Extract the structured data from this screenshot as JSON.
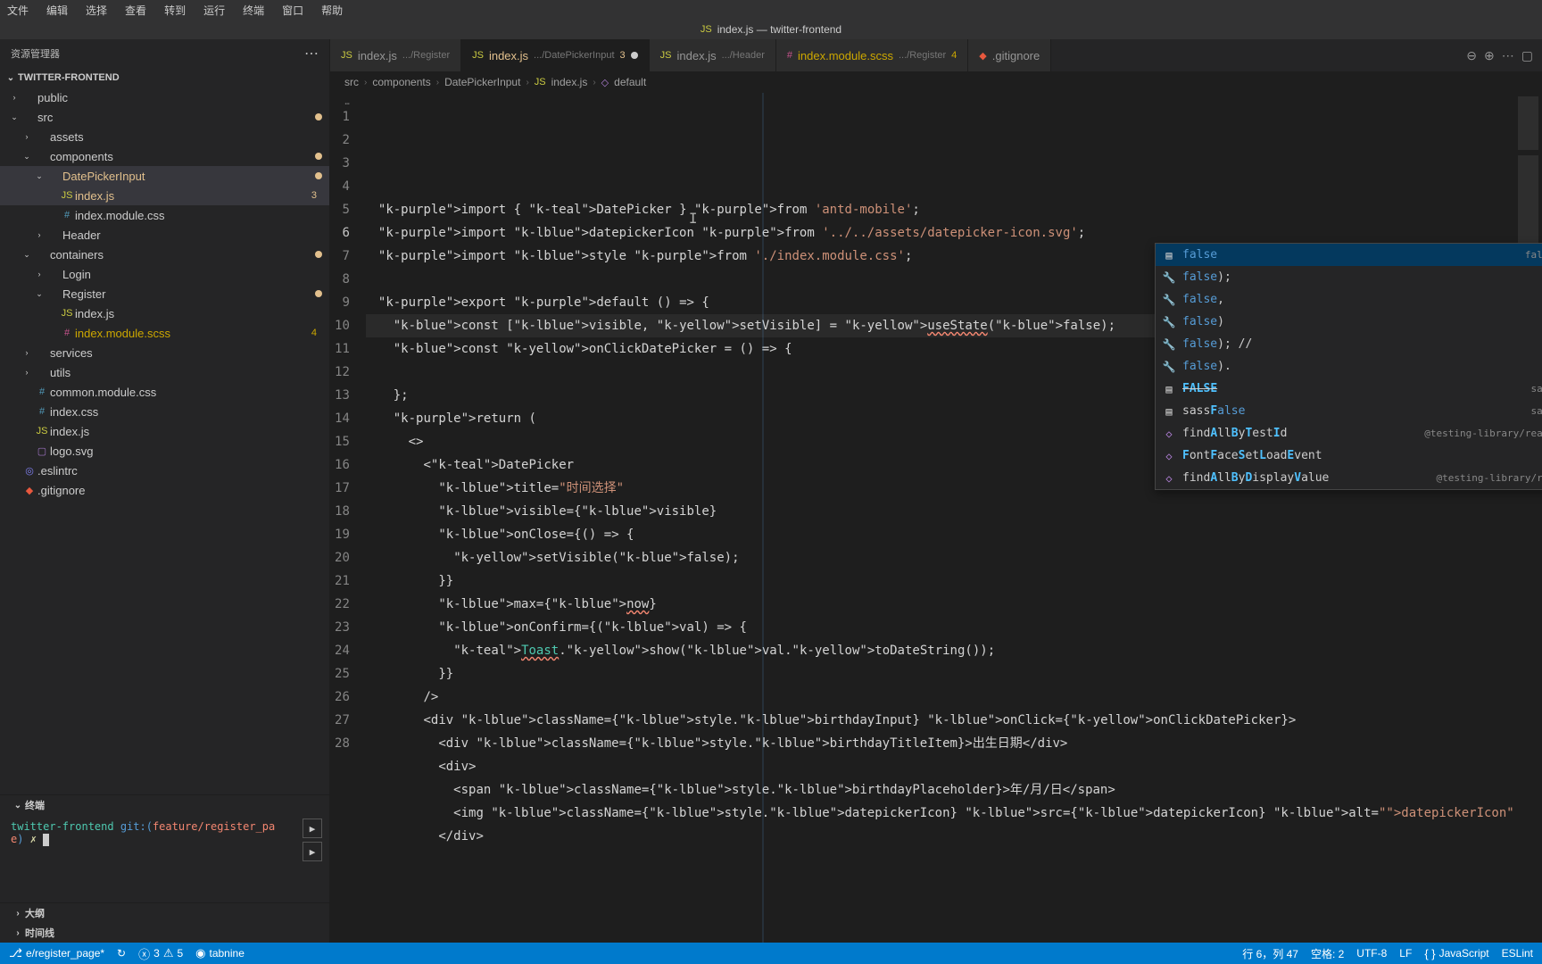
{
  "menubar": [
    "文件",
    "编辑",
    "选择",
    "查看",
    "转到",
    "运行",
    "终端",
    "窗口",
    "帮助"
  ],
  "title": "index.js — twitter-frontend",
  "sidebar": {
    "header": "资源管理器",
    "project": "TWITTER-FRONTEND",
    "tree": [
      {
        "d": 0,
        "exp": ">",
        "icon": "folder",
        "label": "public"
      },
      {
        "d": 0,
        "exp": "v",
        "icon": "folder",
        "label": "src",
        "dot": "#e2c08d"
      },
      {
        "d": 1,
        "exp": ">",
        "icon": "folder",
        "label": "assets"
      },
      {
        "d": 1,
        "exp": "v",
        "icon": "folder",
        "label": "components",
        "dot": "#e2c08d"
      },
      {
        "d": 2,
        "exp": "v",
        "icon": "folder",
        "label": "DatePickerInput",
        "dot": "#e2c08d",
        "active": true,
        "cls": "orange"
      },
      {
        "d": 3,
        "icon": "js",
        "label": "index.js",
        "badge": "3",
        "cls": "orange",
        "active": true
      },
      {
        "d": 3,
        "icon": "css",
        "label": "index.module.css"
      },
      {
        "d": 2,
        "exp": ">",
        "icon": "folder",
        "label": "Header"
      },
      {
        "d": 1,
        "exp": "v",
        "icon": "folder",
        "label": "containers",
        "dot": "#e2c08d"
      },
      {
        "d": 2,
        "exp": ">",
        "icon": "folder",
        "label": "Login"
      },
      {
        "d": 2,
        "exp": "v",
        "icon": "folder",
        "label": "Register",
        "dot": "#e2c08d"
      },
      {
        "d": 3,
        "icon": "js",
        "label": "index.js"
      },
      {
        "d": 3,
        "icon": "scss",
        "label": "index.module.scss",
        "badge": "4",
        "cls": "yellow"
      },
      {
        "d": 1,
        "exp": ">",
        "icon": "folder",
        "label": "services"
      },
      {
        "d": 1,
        "exp": ">",
        "icon": "folder",
        "label": "utils"
      },
      {
        "d": 1,
        "icon": "css",
        "label": "common.module.css"
      },
      {
        "d": 1,
        "icon": "css",
        "label": "index.css"
      },
      {
        "d": 1,
        "icon": "js",
        "label": "index.js"
      },
      {
        "d": 1,
        "icon": "svg",
        "label": "logo.svg"
      },
      {
        "d": 0,
        "icon": "eslint",
        "label": ".eslintrc"
      },
      {
        "d": 0,
        "icon": "git",
        "label": ".gitignore"
      }
    ],
    "terminal_header": "终端",
    "outline": "大纲",
    "timeline": "时间线"
  },
  "terminal": {
    "line1_a": "twitter-frontend",
    "line1_b": "git:(",
    "line1_c": "feature/register_pa",
    "line2_a": "e",
    "line2_b": ") ",
    "line2_c": "✗"
  },
  "tabs": [
    {
      "icon": "js",
      "name": "index.js",
      "path": ".../Register"
    },
    {
      "icon": "js",
      "name": "index.js",
      "path": ".../DatePickerInput",
      "badge": "3",
      "badgeCls": "orange",
      "active": true,
      "dirty": true
    },
    {
      "icon": "js",
      "name": "index.js",
      "path": ".../Header"
    },
    {
      "icon": "scss",
      "name": "index.module.scss",
      "path": ".../Register",
      "badge": "4",
      "badgeCls": "yellow"
    },
    {
      "icon": "git",
      "name": ".gitignore"
    }
  ],
  "breadcrumbs": [
    "src",
    "components",
    "DatePickerInput",
    "index.js",
    "default"
  ],
  "gutter_fold": "⋯",
  "lines": {
    "1": "import { DatePicker } from 'antd-mobile';",
    "2": "import datepickerIcon from '../../assets/datepicker-icon.svg';",
    "3": "import style from './index.module.css';",
    "5": "export default () => {",
    "6": "  const [visible, setVisible] = useState(false);",
    "7": "  const onClickDatePicker = () => {",
    "9": "  };",
    "10": "  return (",
    "11": "    <>",
    "12": "      <DatePicker",
    "13": "        title=\"时间选择\"",
    "14": "        visible={visible}",
    "15": "        onClose={() => {",
    "16": "          setVisible(false);",
    "17": "        }}",
    "18": "        max={now}",
    "19": "        onConfirm={(val) => {",
    "20": "          Toast.show(val.toDateString());",
    "21": "        }}",
    "22": "      />",
    "23": "      <div className={style.birthdayInput} onClick={onClickDatePicker}>",
    "24": "        <div className={style.birthdayTitleItem}>出生日期</div>",
    "25": "        <div>",
    "26": "          <span className={style.birthdayPlaceholder}>年/月/日</span>",
    "27": "          <img className={style.datepickerIcon} src={datepickerIcon} alt=\"datepickerIcon\"",
    "28": "        </div>"
  },
  "suggest": [
    {
      "icon": "snip",
      "label": "false",
      "detail": "false",
      "sel": true
    },
    {
      "icon": "wrench",
      "label": "false);"
    },
    {
      "icon": "wrench",
      "label": "false,"
    },
    {
      "icon": "wrench",
      "label": "false)"
    },
    {
      "icon": "wrench",
      "label": "false); //"
    },
    {
      "icon": "wrench",
      "label": "false)."
    },
    {
      "icon": "snip",
      "label": "FALSE",
      "detail": "sass",
      "strike": true
    },
    {
      "icon": "snip",
      "label": "sassFalse",
      "detail": "sass"
    },
    {
      "icon": "box",
      "label": "findAllByTestId",
      "detail": "@testing-library/react"
    },
    {
      "icon": "box",
      "label": "FontFaceSetLoadEvent"
    },
    {
      "icon": "box",
      "label": "findAllByDisplayValue",
      "detail": "@testing-library/re…"
    }
  ],
  "status": {
    "branch": "e/register_page*",
    "sync": "↻",
    "errors": "3",
    "warnings": "5",
    "tabnine": "tabnine",
    "cursor": "行 6，列 47",
    "spaces": "空格: 2",
    "encoding": "UTF-8",
    "eol": "LF",
    "lang": "JavaScript",
    "eslint": "ESLint"
  }
}
